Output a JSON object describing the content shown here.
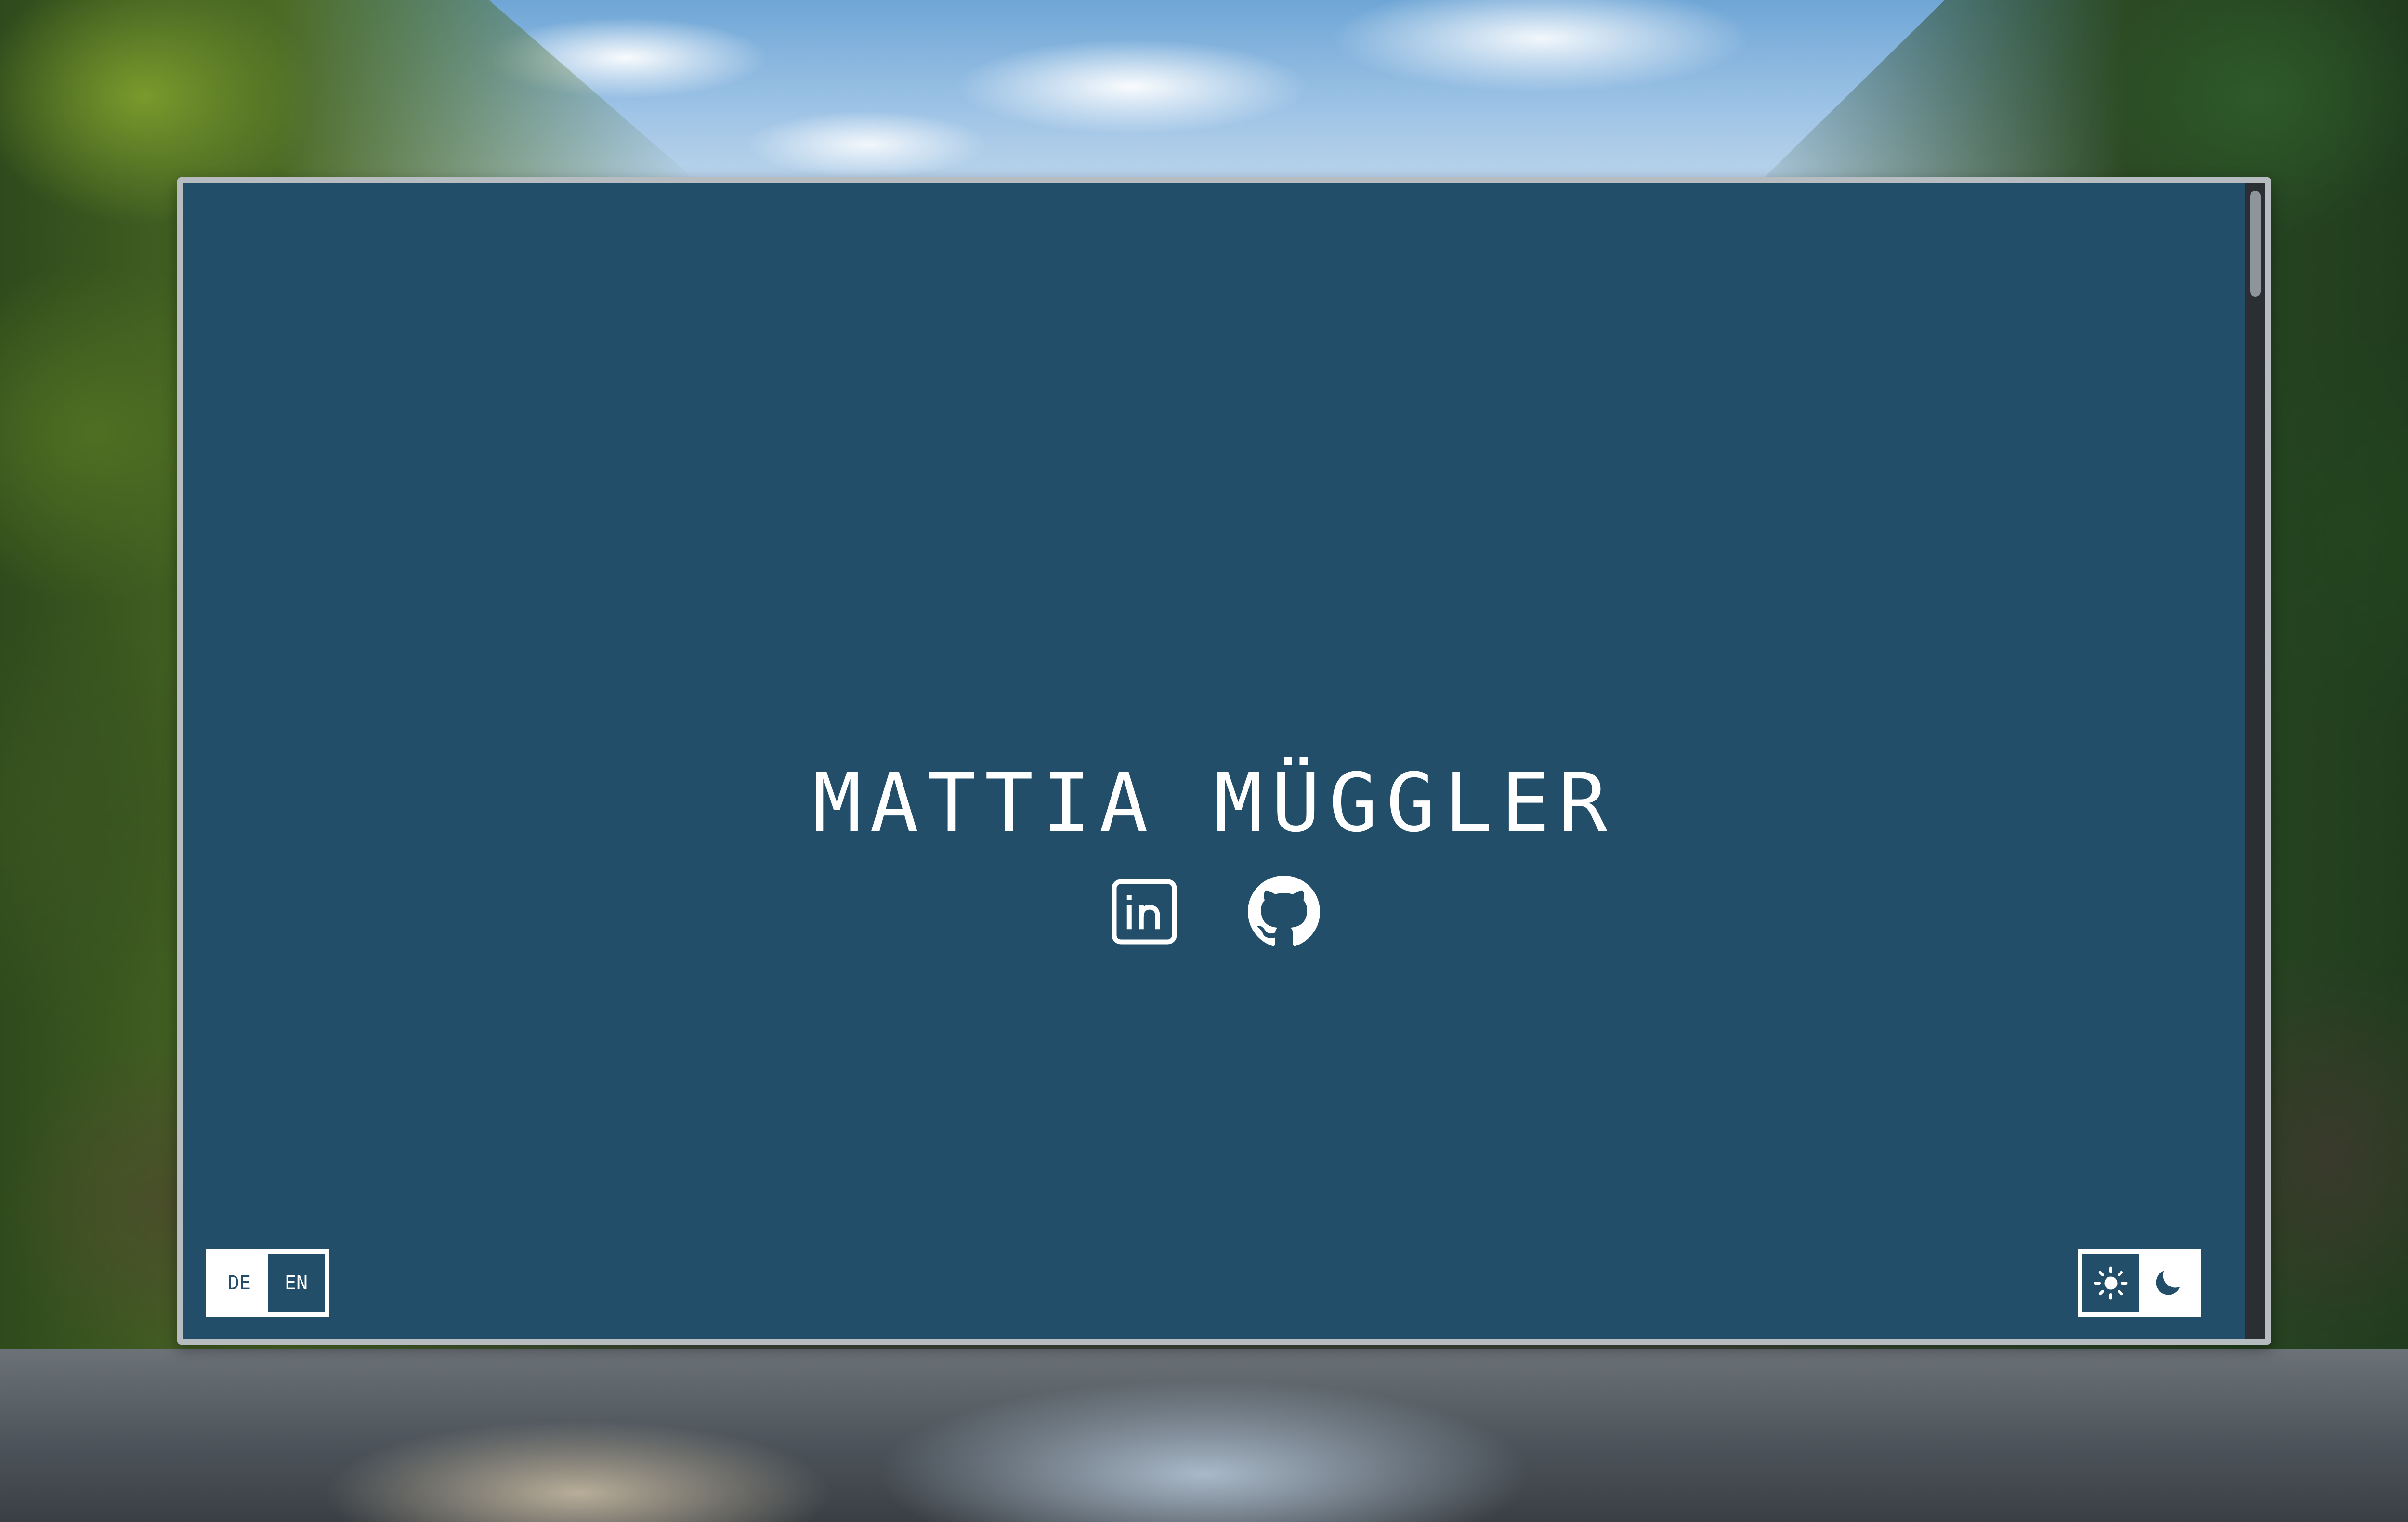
{
  "page": {
    "title": "MATTIA MÜGGLER"
  },
  "social": [
    {
      "name": "LinkedIn",
      "icon": "linkedin-icon"
    },
    {
      "name": "GitHub",
      "icon": "github-icon"
    }
  ],
  "language_toggle": {
    "options": [
      {
        "label": "DE",
        "selected": false
      },
      {
        "label": "EN",
        "selected": true
      }
    ]
  },
  "theme_toggle": {
    "options": [
      {
        "icon": "sun-icon",
        "value": "light",
        "selected": true
      },
      {
        "icon": "moon-icon",
        "value": "dark",
        "selected": false
      }
    ]
  },
  "colors": {
    "window_background": "#234e6a",
    "text": "#ffffff",
    "window_border": "#b7bcc0"
  }
}
